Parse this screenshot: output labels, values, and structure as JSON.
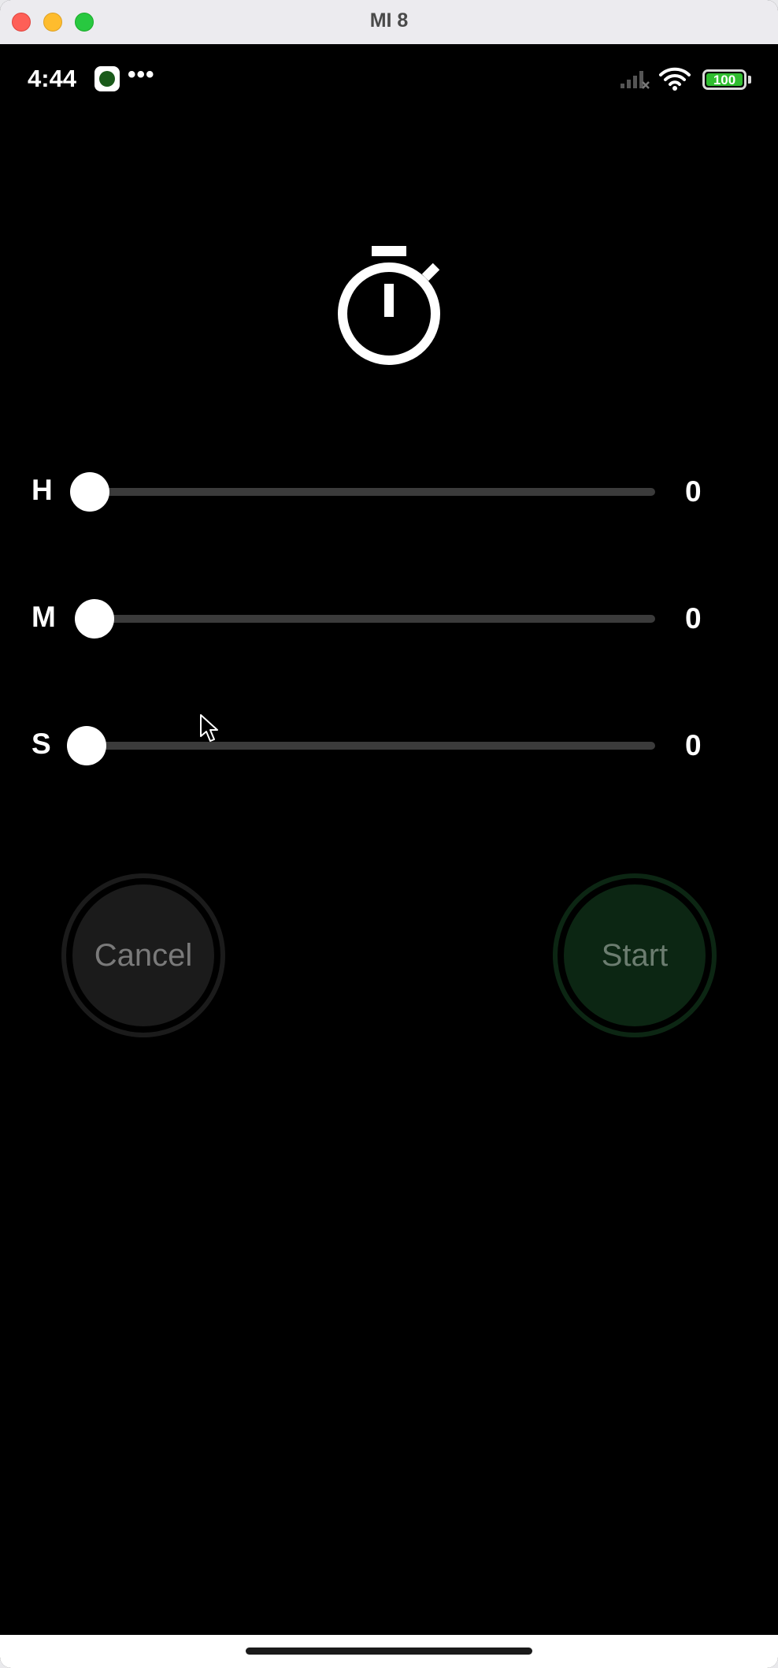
{
  "window": {
    "title": "MI 8"
  },
  "status_bar": {
    "time": "4:44",
    "more_indicator": "•••",
    "battery_level": "100"
  },
  "timer": {
    "rows": [
      {
        "label": "H",
        "value": "0"
      },
      {
        "label": "M",
        "value": "0"
      },
      {
        "label": "S",
        "value": "0"
      }
    ],
    "cancel_label": "Cancel",
    "start_label": "Start"
  },
  "colors": {
    "background": "#000000",
    "cancel_fill": "#1b1b1b",
    "start_fill": "#0c2613",
    "track": "#3b3b3b",
    "battery_fill": "#2fbd2f"
  },
  "icons": [
    "stopwatch-icon",
    "signal-icon",
    "wifi-icon",
    "battery-icon",
    "app-notification-icon",
    "cursor-icon"
  ]
}
